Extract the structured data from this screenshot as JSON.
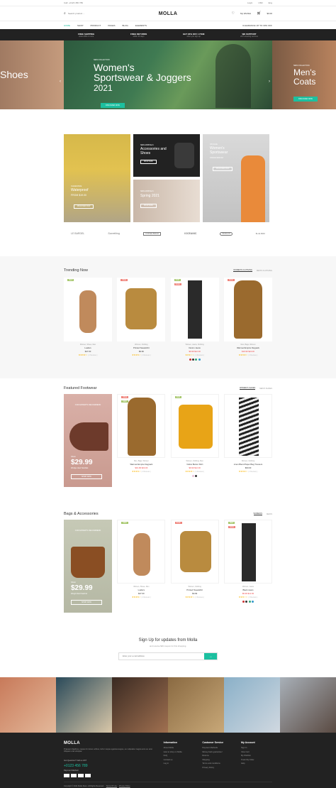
{
  "topbar": {
    "phone": "Call: +0123 456 789",
    "login": "Login",
    "currency": "USD",
    "lang": "Eng"
  },
  "header": {
    "logo": "MOLLA",
    "search_placeholder": "Search product ...",
    "wishlist": "My Wishlist",
    "wishlist_count": "3",
    "cart_count": "2",
    "cart_total": "$0.00"
  },
  "nav": {
    "items": [
      "HOME",
      "SHOP",
      "PRODUCT",
      "PAGES",
      "BLOG",
      "ELEMENTS"
    ],
    "promo": "CLEARANCE UP TO 30% OFF"
  },
  "features": [
    {
      "title": "FREE SHIPPING",
      "sub": "orders $50 or more"
    },
    {
      "title": "FREE RETURNS",
      "sub": "within 30 days"
    },
    {
      "title": "GET 20% OFF 1 ITEM",
      "sub": "when you sign up"
    },
    {
      "title": "WE SUPPORT",
      "sub": "24/7 amazing services"
    }
  ],
  "hero": {
    "left": "Shoes",
    "eyebrow": "NEW COLLECTION",
    "title1": "Women's",
    "title2": "Sportswear & Joggers",
    "year": "2021",
    "cta": "DISCOVER NOW",
    "right_eyebrow": "NEW COLLECTION",
    "right1": "Men's",
    "right2": "Coats",
    "right_cta": "DISCOVER NOW"
  },
  "banners": {
    "b1": {
      "label": "CLEARANCE",
      "title": "Waterproof",
      "price": "FROM $19.00",
      "cta": "DISCOVER NOW"
    },
    "b2": {
      "label": "NEW ARRIVALS",
      "title": "Accessories and Shoes",
      "cta": "SHOP NOW"
    },
    "b3": {
      "label": "NEW ARRIVALS",
      "title": "Spring 2021",
      "cta": "SHOP NOW"
    },
    "b4": {
      "label": "ON SALE",
      "title": "Women's Sportswear",
      "price": "FROM $39.00",
      "cta": "DISCOVER NOW"
    }
  },
  "brands": [
    "LE BARDEL",
    "Something",
    "COFFEE BREAK",
    "IOCEANIC",
    "PENGUIN",
    "BLUE BIRD"
  ],
  "trending": {
    "title": "Trending Now",
    "tabs": [
      "WOMEN'S CLOTHING",
      "MEN'S CLOTHING"
    ],
    "products": [
      {
        "tag": "NEW",
        "cat": "Women, Shoes, Men",
        "name": "Loafers",
        "price": "$47.00",
        "reviews": "( 2 Reviews )",
        "stars": "★★★★☆"
      },
      {
        "tag": "SALE",
        "cat": "Women, Clothing",
        "name": "Printed Sweatshirt",
        "price": "$9.99",
        "reviews": "( 2 Reviews )",
        "stars": "★★★★☆"
      },
      {
        "tag": "NEW",
        "tag2": "SALE",
        "cat": "Women, Jeans, Clothing",
        "name": "Denim Jeans",
        "price": "$9.99 $12.00",
        "reviews": "( 2 Reviews )",
        "stars": "★★★☆☆"
      },
      {
        "tag": "SALE",
        "cat": "Men, Bags, Women",
        "name": "Warmed Empire Daypack",
        "price": "$19.99 $24.00",
        "reviews": "( 3 Reviews )",
        "stars": "★★★★☆"
      }
    ]
  },
  "footwear": {
    "title": "Featured Footwear",
    "tabs": [
      "WOMEN'S SHOES",
      "MEN'S SHOES"
    ],
    "promo": {
      "top": "OUR EXPERTS RECOMMEND",
      "sale": "SALE",
      "price": "$29.99",
      "desc": "Wedge Heel Sandals",
      "cta": "SHOP NOW"
    },
    "products": [
      {
        "tag": "SALE",
        "tag2": "NEW",
        "cat": "Men, Bags, Women",
        "name": "Warmed Empire Daypack",
        "price": "$19.99 $24.00",
        "reviews": "( 2 Reviews )",
        "stars": "★★★★☆"
      },
      {
        "tag": "NEW",
        "cat": "Women, Clothing, Men",
        "name": "Yellow Button Shirt",
        "price": "$9.99 $12.00",
        "reviews": "( 4 Reviews )",
        "stars": "★★★★☆"
      },
      {
        "tag": "",
        "cat": "Women, Clothing",
        "name": "Linen Blend Paper Bag Trousers",
        "price": "$60.00",
        "reviews": "( 2 Reviews )",
        "stars": "★★★★☆"
      }
    ]
  },
  "bags": {
    "title": "Bags & Accessories",
    "tabs": [
      "WOMEN'S",
      "MEN'S"
    ],
    "promo": {
      "top": "OUR EXPERTS RECOMMEND",
      "sale": "SALE",
      "price": "$29.99",
      "desc": "Weigh Field Satchel",
      "cta": "SHOP NOW"
    },
    "products": [
      {
        "tag": "NEW",
        "cat": "Women, Shoes, Men",
        "name": "Loafers",
        "price": "$47.00",
        "reviews": "( 2 Reviews )",
        "stars": "★★★★☆"
      },
      {
        "tag": "SALE",
        "cat": "Women, Clothing",
        "name": "Printed Sweatshirt",
        "price": "$9.99",
        "reviews": "( 2 Reviews )",
        "stars": "★★★★☆"
      },
      {
        "tag": "NEW",
        "tag2": "SALE",
        "cat": "Women, Jeans",
        "name": "Black Jeans",
        "price": "$9.99 $12.00",
        "reviews": "( 3 Reviews )",
        "stars": "★★★☆☆"
      }
    ]
  },
  "signup": {
    "title": "Sign Up for updates from Molla",
    "sub": "and receive $20 coupon for first shopping.",
    "placeholder": "Enter your e-mail address",
    "btn": "→"
  },
  "footer": {
    "logo": "MOLLA",
    "about": "Praesent dapibus, neque id cursus ucibus, tortor neque egestas augue, eu vulputate magna eros eu erat. Aliquam erat volutpat.",
    "q": "Got Question? Call us 24/7",
    "phone": "+0123 456 789",
    "payment": "Payment Method",
    "info_title": "Information",
    "info": [
      "About Molla",
      "How to shop on Molla",
      "FAQ",
      "Contact us",
      "Log in"
    ],
    "cs_title": "Customer Service",
    "cs": [
      "Payment Methods",
      "Money-back guarantee!",
      "Returns",
      "Shipping",
      "Terms and conditions",
      "Privacy Policy"
    ],
    "acc_title": "My Account",
    "acc": [
      "Sign In",
      "View Cart",
      "My Wishlist",
      "Track My Order",
      "Help"
    ],
    "copy": "Copyright © 2021 Molla Store. All Rights Reserved.",
    "terms": "Terms Of Use",
    "privacy": "Privacy Policy"
  },
  "colors": {
    "accent": "#1cc0a0",
    "sale": "#ef837b",
    "new": "#a6c76c",
    "top": "#1cc0a0"
  }
}
